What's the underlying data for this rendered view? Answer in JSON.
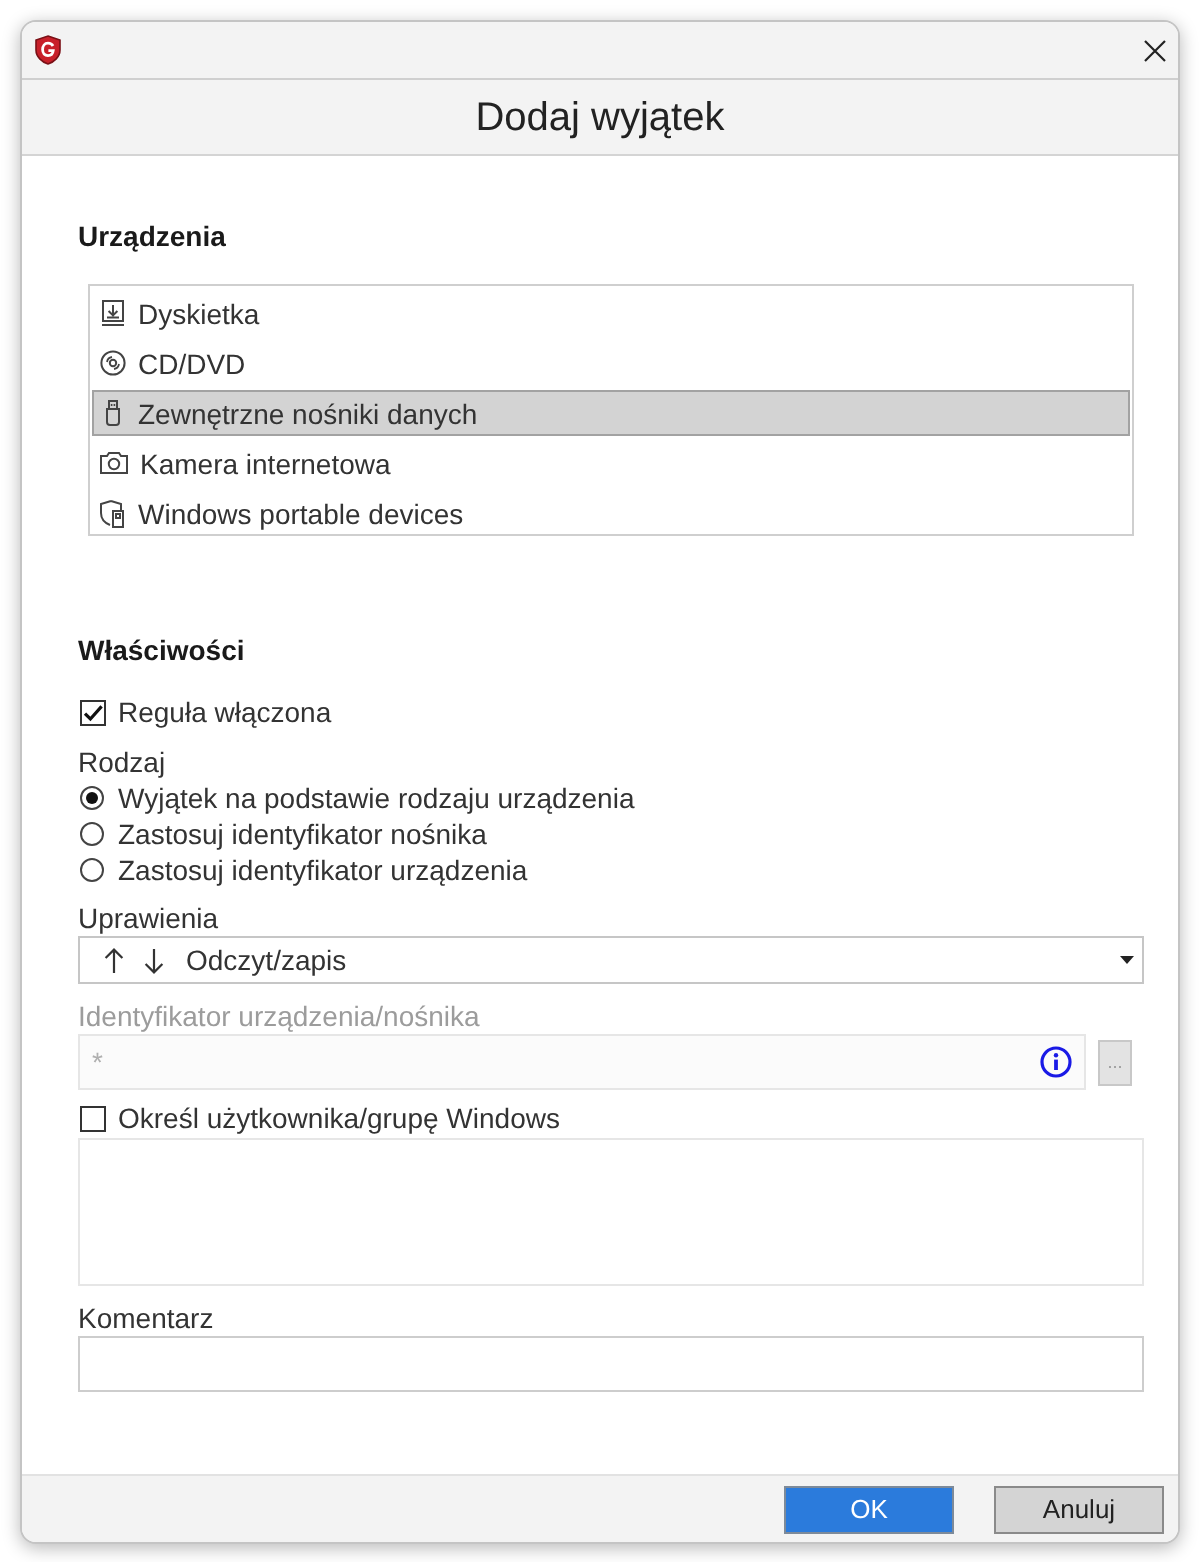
{
  "window": {
    "title": "Dodaj wyjątek"
  },
  "devices": {
    "heading": "Urządzenia",
    "items": [
      {
        "label": "Dyskietka",
        "kind": "floppy",
        "selected": false
      },
      {
        "label": "CD/DVD",
        "kind": "disc",
        "selected": false
      },
      {
        "label": "Zewnętrzne nośniki danych",
        "kind": "usb",
        "selected": true
      },
      {
        "label": "Kamera internetowa",
        "kind": "camera",
        "selected": false
      },
      {
        "label": "Windows portable devices",
        "kind": "portable",
        "selected": false
      }
    ]
  },
  "properties": {
    "heading": "Właściwości",
    "rule_enabled": {
      "label": "Reguła włączona",
      "checked": true
    },
    "type": {
      "label": "Rodzaj",
      "options": [
        {
          "label": "Wyjątek na podstawie rodzaju urządzenia",
          "selected": true
        },
        {
          "label": "Zastosuj identyfikator nośnika",
          "selected": false
        },
        {
          "label": "Zastosuj identyfikator urządzenia",
          "selected": false
        }
      ]
    },
    "permissions": {
      "label": "Uprawienia",
      "value": "Odczyt/zapis"
    },
    "identifier": {
      "label": "Identyfikator urządzenia/nośnika",
      "placeholder": "*",
      "disabled": true,
      "browse_label": "..."
    },
    "windows_user": {
      "label": "Określ użytkownika/grupę Windows",
      "checked": false
    },
    "comment": {
      "label": "Komentarz"
    }
  },
  "buttons": [
    {
      "label": "OK",
      "kind": "primary"
    },
    {
      "label": "Anuluj",
      "kind": "secondary"
    }
  ]
}
